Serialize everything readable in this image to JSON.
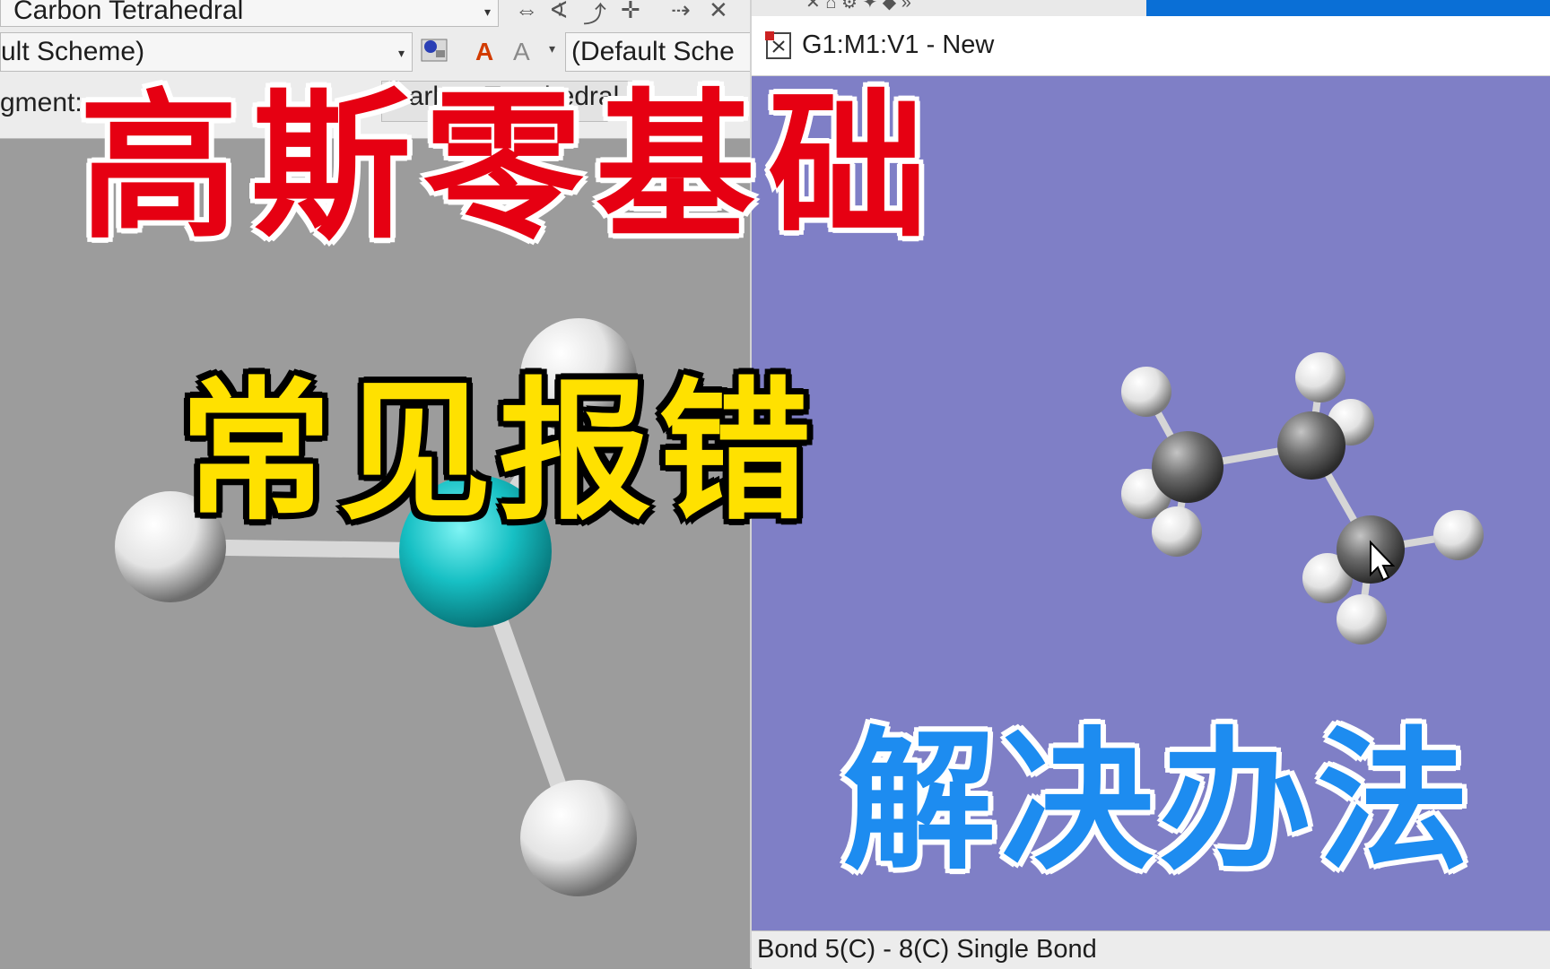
{
  "builder": {
    "element_combo": "Carbon Tetrahedral",
    "color_scheme_combo": "ult Scheme)",
    "color_scheme_combo2": "(Default Sche",
    "fragment_label": "gment:",
    "fragment_value": "Carbon Tetrahedral"
  },
  "molecule_window": {
    "title": "G1:M1:V1 - New",
    "status": "Bond 5(C) - 8(C)  Single Bond",
    "canvas_color": "#7f7fc6"
  },
  "overlay": {
    "title_main": "高斯零基础",
    "title_sub": "常见报错",
    "title_solution": "解决办法"
  },
  "icons": [
    "toolbar-icons",
    "document-icon",
    "cursor-icon"
  ]
}
